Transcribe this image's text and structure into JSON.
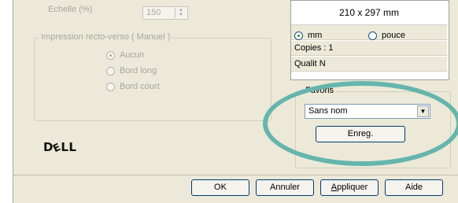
{
  "scale": {
    "label": "Echelle (%)",
    "value": "150"
  },
  "preview": {
    "paper_size": "210 x 297 mm",
    "unit_mm": "mm",
    "unit_inch": "pouce",
    "selected_unit": "mm",
    "copies": "Copies : 1",
    "quality_partial": "Qualit  N"
  },
  "duplex": {
    "title": "Impression recto-verso ( Manuel )",
    "options": [
      "Aucun",
      "Bord long",
      "Bord court"
    ],
    "selected": "Aucun"
  },
  "favorites": {
    "title": "Favoris",
    "selected_value": "Sans nom",
    "save_label": "Enreg."
  },
  "brand": {
    "logo_text": "DELL"
  },
  "footer": {
    "ok_label": "OK",
    "cancel_label": "Annuler",
    "apply_label": "Appliquer",
    "apply_mnemonic": "A",
    "apply_rest": "ppliquer",
    "help_label": "Aide"
  },
  "highlight": {
    "color": "#66b5ad"
  }
}
